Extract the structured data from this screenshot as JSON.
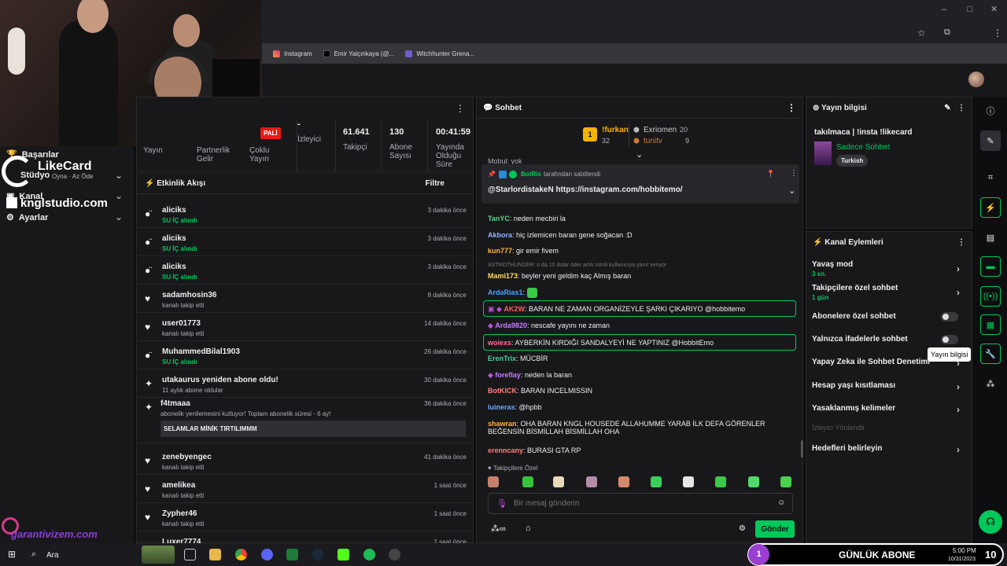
{
  "browser": {
    "bookmarks": [
      "Instagram",
      "Emir Yalçınkaya (@...",
      "Witchhunter Grena..."
    ]
  },
  "overlay": {
    "nav": [
      "Başarılar",
      "Stüdyo",
      "Kanal",
      "Ayarlar"
    ],
    "likecard_title": "LikeCard",
    "likecard_sub": "Oyna · Az Öde",
    "kngl": "knglstudio.com",
    "garanti": "garantivizem.com"
  },
  "stats": {
    "badge": "PALİ",
    "items": [
      {
        "value": "",
        "label": "Yayın"
      },
      {
        "value": "",
        "label": "Partnerlik Gelir"
      },
      {
        "value": "",
        "label": "Çoklu Yayın"
      },
      {
        "value": "-",
        "label": "İzleyici"
      },
      {
        "value": "61.641",
        "label": "Takipçi"
      },
      {
        "value": "130",
        "label": "Abone Sayısı"
      },
      {
        "value": "00:41:59",
        "label": "Yayında Olduğu Süre"
      }
    ]
  },
  "activity": {
    "title": "Etkinlik Akışı",
    "filter": "Filtre",
    "items": [
      {
        "name": "aliciks",
        "sub": "SU İÇ alındı",
        "time": "3 dakika önce",
        "icon": "drops-icon",
        "green": true
      },
      {
        "name": "aliciks",
        "sub": "SU İÇ alındı",
        "time": "3 dakika önce",
        "icon": "drops-icon",
        "green": true
      },
      {
        "name": "aliciks",
        "sub": "SU İÇ alındı",
        "time": "3 dakika önce",
        "icon": "drops-icon",
        "green": true
      },
      {
        "name": "sadamhosin36",
        "sub": "kanalı takip etti",
        "time": "8 dakika önce",
        "icon": "heart-icon",
        "green": false
      },
      {
        "name": "user01773",
        "sub": "kanalı takip etti",
        "time": "14 dakika önce",
        "icon": "heart-icon",
        "green": false
      },
      {
        "name": "MuhammedBilal1903",
        "sub": "SU İÇ alındı",
        "time": "26 dakika önce",
        "icon": "drops-icon",
        "green": true
      },
      {
        "name": "utakaurus yeniden abone oldu!",
        "sub": "11 aylık abone oldular",
        "time": "30 dakika önce",
        "icon": "star-icon",
        "green": false
      },
      {
        "name": "zenebyengec",
        "sub": "kanalı takip etti",
        "time": "41 dakika önce",
        "icon": "heart-icon",
        "green": false
      },
      {
        "name": "amelikea",
        "sub": "kanalı takip etti",
        "time": "1 saat önce",
        "icon": "heart-icon",
        "green": false
      },
      {
        "name": "Zypher46",
        "sub": "kanalı takip etti",
        "time": "1 saat önce",
        "icon": "heart-icon",
        "green": false
      },
      {
        "name": "Luxer7774",
        "sub": "",
        "time": "1 saat önce",
        "icon": "heart-icon",
        "green": false
      }
    ],
    "resub": {
      "name": "f4tmaaa",
      "sub": "abonelik yenilemesini kutluyor! Toplam abonelik süresi - 6 ay!",
      "msg": "SELAMLAR MİNİK TIRTILIMMM",
      "time": "36 dakika önce"
    }
  },
  "chat": {
    "title": "Sohbet",
    "leaders": [
      {
        "rank": "1",
        "name": "!furkan",
        "score": "32"
      },
      {
        "name": "Exriomen",
        "score": "20"
      },
      {
        "name": "tunitv",
        "score": "9"
      }
    ],
    "pinned_by": "BotRix",
    "pinned_suffix": "tarafından sabitlendi",
    "pinned_msg": "@StarlordistakeN https://instagram.com/hobbitemo/",
    "top_fragment": "Mobul: yok",
    "messages": [
      {
        "user": "TanYC",
        "text": "neden mecbiri la",
        "color": "#5fd38a"
      },
      {
        "user": "Akbora",
        "text": "hiç izlemicen baran gene soğacan :D",
        "color": "#8fb4ff"
      },
      {
        "user": "kun777",
        "text": "gir emir fivem",
        "color": "#ffb347"
      },
      {
        "user": "",
        "text": "ASTROTHUNDER: o da 10 dolar öder artık isimli kullanıcıya yanıt veriyor",
        "color": "#777"
      },
      {
        "user": "Mami173",
        "text": "beyler yeni geldim kaç Almış baran",
        "color": "#ffd76a"
      },
      {
        "user": "ArdaRias1",
        "text": "",
        "color": "#4aa3ff"
      },
      {
        "user": "AK2W",
        "text": "BARAN NE ZAMAN ORGANİZEYLE ŞARKI ÇIKARIYO @hobbitemo",
        "color": "#ff5c5c"
      },
      {
        "user": "Arda9820",
        "text": "nescafe yayını ne zaman",
        "color": "#c67cff"
      },
      {
        "user": "woiexs",
        "text": "AYBERKİN KIRDIĞI SANDALYEYİ NE YAPTINIZ @HobbitEmo",
        "color": "#ff6b9a"
      },
      {
        "user": "ErenTrix",
        "text": "MÜCBİR",
        "color": "#4dd0a6"
      },
      {
        "user": "foreflay",
        "text": "neden la baran",
        "color": "#c67cff"
      },
      {
        "user": "BotKICK",
        "text": "BARAN INCELMISSIN",
        "color": "#ff7c7c"
      },
      {
        "user": "luineras",
        "text": "@hpbb",
        "color": "#6ea8ff"
      },
      {
        "user": "shawran",
        "text": "OHA BARAN KNGL HOUSEDE ALLAHUMME YARAB İLK DEFA GÖRENLER BEĞENSİN BİSMİLLAH BİSMİLLAH OHA",
        "color": "#ffb347"
      },
      {
        "user": "erenncany",
        "text": "BURASI GTA RP",
        "color": "#ff7c7c"
      }
    ],
    "followers_only": "Takipçilere Özel",
    "placeholder": "Bir mesaj gönderin",
    "send": "Gönder"
  },
  "stream_info": {
    "title": "Yayın bilgisi",
    "stream_title": "takılmaca | !insta !likecard",
    "category": "Sadece Sohbet",
    "tag": "Turkish"
  },
  "channel_actions": {
    "title": "Kanal Eylemleri",
    "items": [
      {
        "label": "Yavaş mod",
        "sub": "3 sn.",
        "type": "chev"
      },
      {
        "label": "Takipçilere özel sohbet",
        "sub": "1 gün",
        "type": "chev"
      },
      {
        "label": "Abonelere özel sohbet",
        "sub": "",
        "type": "toggle"
      },
      {
        "label": "Yalnızca ifadelerle sohbet",
        "sub": "",
        "type": "toggle"
      },
      {
        "label": "Yapay Zeka ile Sohbet Denetimi",
        "sub": "",
        "type": "chev"
      },
      {
        "label": "Hesap yaşı kısıtlaması",
        "sub": "",
        "type": "chev"
      },
      {
        "label": "Yasaklanmış kelimeler",
        "sub": "",
        "type": "chev"
      },
      {
        "label": "İzleyici Yönlendir",
        "sub": "",
        "type": "none"
      },
      {
        "label": "Hedefleri belirleyin",
        "sub": "",
        "type": "chev"
      }
    ]
  },
  "tooltip": "Yayın bilgisi",
  "taskbar": {
    "search": "Ara",
    "time": "5:00 PM",
    "date": "10/31/2023",
    "goal_count": "1",
    "goal_label": "GÜNLÜK ABONE",
    "goal_target": "10"
  },
  "colors": {
    "accent": "#00c85a",
    "panel": "#18181b",
    "bg": "#0e0e10"
  }
}
